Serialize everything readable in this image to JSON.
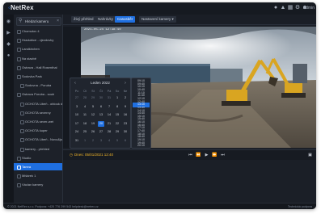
{
  "app": {
    "logo_prefix": "◦",
    "logo": "NetRex"
  },
  "topbar": {
    "user": "Admin",
    "icons": [
      "bell-icon",
      "warning-icon",
      "grid-icon",
      "gear-icon",
      "user-icon"
    ]
  },
  "search": {
    "value": "Hledat kameru"
  },
  "sidebar": {
    "items": [
      {
        "label": "Chomutov 4"
      },
      {
        "label": "Hradubice - vjezdovky"
      },
      {
        "label": "Landkirchen"
      },
      {
        "label": "Na stavbě"
      },
      {
        "label": "Ostrava - Hall Rosenthal"
      },
      {
        "label": "Sodovka Park"
      },
      {
        "label": "Sodovna - Poruba"
      },
      {
        "label": "Ostrava Poruba - souh"
      },
      {
        "label": "OCHOTA Libeň - oblouk dložit..."
      },
      {
        "label": "OCHOTA severny"
      },
      {
        "label": "OCHOTA sever-wet"
      },
      {
        "label": "OCHOTA kuper"
      },
      {
        "label": "OCHOTA Libeň - Novo&jsk"
      },
      {
        "label": "kamery - přehled"
      },
      {
        "label": "Studio"
      },
      {
        "label": "Tamra"
      },
      {
        "label": "Mišárek 1"
      },
      {
        "label": "Václav kamery"
      }
    ],
    "selected_index": 15
  },
  "tabs": [
    {
      "label": "Živý přehled"
    },
    {
      "label": "Nahrávky"
    },
    {
      "label": "Casosběr"
    },
    {
      "label": "Nastavení kamery ▾"
    }
  ],
  "active_tab": 2,
  "video": {
    "overlay": "2021-05-24 12:38:40"
  },
  "calendar": {
    "month_label": "Leden 2022",
    "weekdays": [
      "Po",
      "Út",
      "St",
      "Čt",
      "Pá",
      "So",
      "Ne"
    ],
    "weeks": [
      [
        "27",
        "28",
        "29",
        "30",
        "31",
        "1",
        "2"
      ],
      [
        "3",
        "4",
        "5",
        "6",
        "7",
        "8",
        "9"
      ],
      [
        "10",
        "11",
        "12",
        "13",
        "14",
        "15",
        "16"
      ],
      [
        "17",
        "18",
        "19",
        "20",
        "21",
        "22",
        "23"
      ],
      [
        "24",
        "25",
        "26",
        "27",
        "28",
        "29",
        "30"
      ],
      [
        "31",
        "1",
        "2",
        "3",
        "4",
        "5",
        "6"
      ]
    ],
    "selected": {
      "week": 3,
      "day": 3
    }
  },
  "times": [
    "09:10",
    "09:40",
    "10:10",
    "10:40",
    "11:10",
    "11:40",
    "12:10",
    "12:40",
    "13:10",
    "13:40",
    "14:10",
    "14:40",
    "15:10",
    "15:40",
    "16:10",
    "16:40",
    "17:10",
    "17:40",
    "18:10",
    "18:40",
    "19:10",
    "19:40",
    "20:10"
  ],
  "selected_time_index": 8,
  "controls": {
    "time_label": "Dnes: 05/01/2021 12:40"
  },
  "footer": {
    "left": "© 2021 NetRex s.r.o.    Podpora: +420 776 299 543    helpdesk@netrex.cz",
    "right": "Technická podpora"
  },
  "colors": {
    "accent": "#1f6fe0",
    "highlight": "#f0b429",
    "background": "#1b1f27"
  }
}
